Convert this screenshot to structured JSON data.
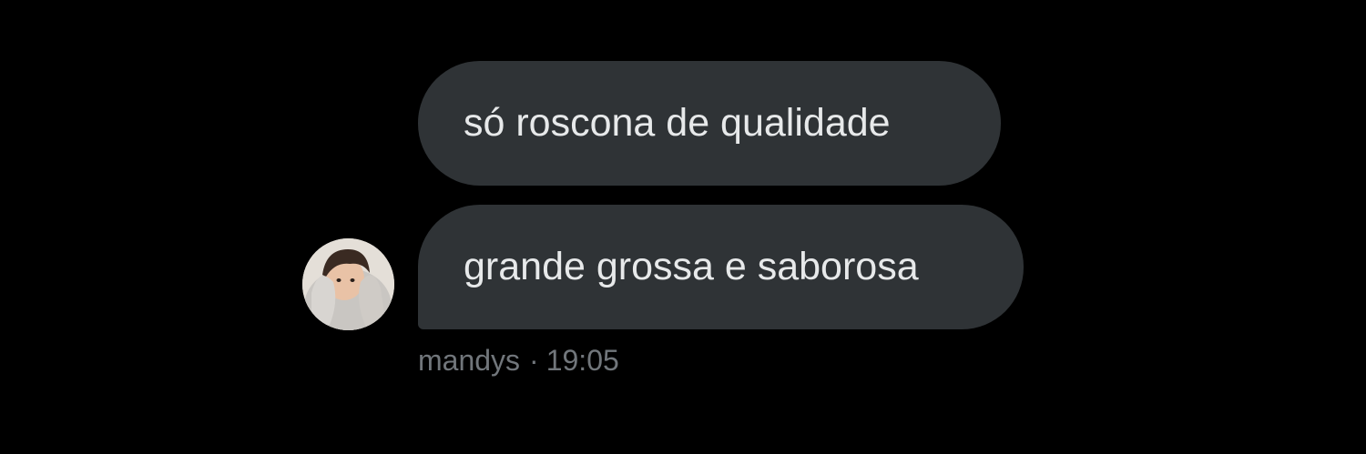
{
  "conversation": {
    "messages": [
      {
        "text": "só roscona de qualidade"
      },
      {
        "text": "grande grossa e saborosa"
      }
    ],
    "sender": "mandys",
    "separator": "·",
    "time": "19:05"
  },
  "colors": {
    "background": "#000000",
    "bubble": "#2f3336",
    "bubble_text": "#e7e9ea",
    "meta_text": "#71767b"
  }
}
